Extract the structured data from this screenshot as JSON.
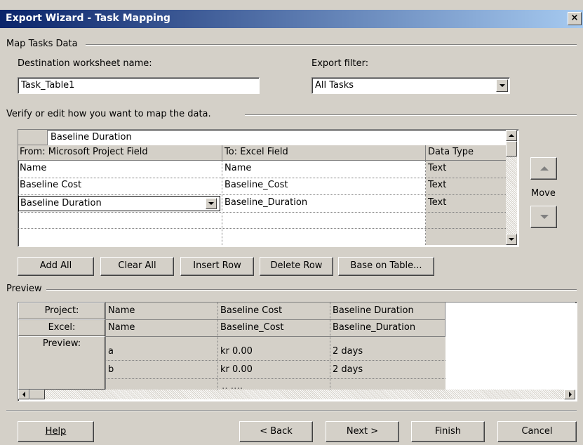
{
  "window": {
    "title": "Export Wizard - Task Mapping",
    "close_label": "×"
  },
  "map_tasks": {
    "legend": "Map Tasks Data",
    "dest_label": "Destination worksheet name:",
    "dest_value": "Task_Table1",
    "filter_label": "Export filter:",
    "filter_value": "All Tasks"
  },
  "mapping": {
    "legend": "Verify or edit how you want to map the data.",
    "edit_value": "Baseline Duration",
    "headers": [
      "From: Microsoft Project Field",
      "To:  Excel Field",
      "Data Type"
    ],
    "rows": [
      [
        "Name",
        "Name",
        "Text"
      ],
      [
        "Baseline Cost",
        "Baseline_Cost",
        "Text"
      ],
      [
        "Baseline Duration",
        "Baseline_Duration",
        "Text"
      ]
    ],
    "move_label": "Move"
  },
  "buttons": {
    "add_all": "Add All",
    "clear_all": "Clear All",
    "insert_row": "Insert Row",
    "delete_row": "Delete Row",
    "base_on_table": "Base on Table..."
  },
  "preview": {
    "legend": "Preview",
    "row_headers": [
      "Project:",
      "Excel:",
      "Preview:"
    ],
    "project_row": [
      "Name",
      "Baseline Cost",
      "Baseline Duration"
    ],
    "excel_row": [
      "Name",
      "Baseline_Cost",
      "Baseline_Duration"
    ],
    "data_rows": [
      [
        "a",
        "kr 0.00",
        "2 days"
      ],
      [
        "b",
        "kr 0.00",
        "2 days"
      ]
    ]
  },
  "footer": {
    "help": "Help",
    "back": "< Back",
    "next": "Next >",
    "finish": "Finish",
    "cancel": "Cancel"
  }
}
